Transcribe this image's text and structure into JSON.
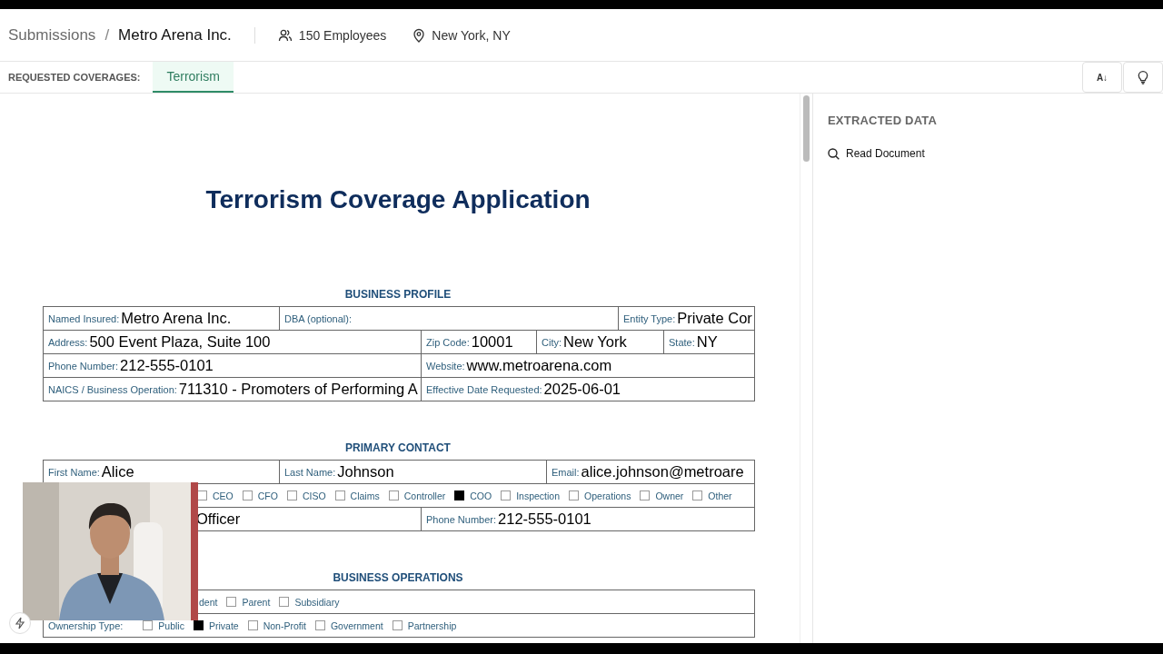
{
  "header": {
    "breadcrumb": [
      {
        "label": "Submissions",
        "selected": false
      },
      {
        "label": "Metro Arena Inc.",
        "selected": true
      }
    ],
    "separator": "/",
    "employees": "150 Employees",
    "location": "New York, NY"
  },
  "coverages": {
    "label": "REQUESTED COVERAGES:",
    "tabs": [
      {
        "label": "Terrorism",
        "selected": true
      }
    ]
  },
  "toolbar": {
    "sort_button": "A↓"
  },
  "document": {
    "title": "Terrorism Coverage Application",
    "sections": [
      {
        "heading": "BUSINESS PROFILE",
        "lines": [
          {
            "fields": [
              {
                "kind": "field",
                "label": "Named Insured:",
                "value": "Metro Arena Inc."
              },
              {
                "kind": "field",
                "label": "DBA (optional):"
              },
              {
                "kind": "field",
                "label": "Entity Type:",
                "value": "Private Cor"
              }
            ]
          },
          {
            "fields": [
              {
                "kind": "field",
                "label": "Address:",
                "value": "500 Event Plaza, Suite 100"
              },
              {
                "kind": "field",
                "label": "Zip Code:",
                "value": "10001"
              },
              {
                "kind": "field",
                "label": "City:",
                "value": "New York"
              },
              {
                "kind": "field",
                "label": "State:",
                "value": "NY"
              }
            ]
          },
          {
            "fields": [
              {
                "kind": "field",
                "label": "Phone Number:",
                "value": "212-555-0101"
              },
              {
                "kind": "field",
                "label": "Website:",
                "value": "www.metroarena.com"
              }
            ]
          },
          {
            "fields": [
              {
                "kind": "field",
                "label": "NAICS / Business Operation:",
                "value": "711310 - Promoters of Performing A"
              },
              {
                "kind": "field",
                "label": "Effective Date Requested:",
                "value": "2025-06-01"
              }
            ]
          }
        ]
      },
      {
        "heading": "PRIMARY CONTACT",
        "lines": [
          {
            "fields": [
              {
                "kind": "field",
                "label": "First Name:",
                "value": "Alice"
              },
              {
                "kind": "field",
                "label": "Last Name:",
                "value": "Johnson"
              },
              {
                "kind": "field",
                "label": "Email:",
                "value": "alice.johnson@metroare"
              }
            ]
          },
          {
            "fields": [
              {
                "kind": "options",
                "items": [
                  {
                    "kind": "checkbox",
                    "label": "CEO",
                    "checked": false
                  },
                  {
                    "kind": "checkbox",
                    "label": "CFO",
                    "checked": false
                  },
                  {
                    "kind": "checkbox",
                    "label": "CISO",
                    "checked": false
                  },
                  {
                    "kind": "checkbox",
                    "label": "Claims",
                    "checked": false
                  },
                  {
                    "kind": "checkbox",
                    "label": "Controller",
                    "checked": false
                  },
                  {
                    "kind": "checkbox",
                    "label": "COO",
                    "checked": true
                  },
                  {
                    "kind": "checkbox",
                    "label": "Inspection",
                    "checked": false
                  },
                  {
                    "kind": "checkbox",
                    "label": "Operations",
                    "checked": false
                  },
                  {
                    "kind": "checkbox",
                    "label": "Owner",
                    "checked": false
                  },
                  {
                    "kind": "checkbox",
                    "label": "Other",
                    "checked": false
                  }
                ]
              }
            ]
          },
          {
            "fields": [
              {
                "kind": "field",
                "value": "Officer"
              },
              {
                "kind": "field",
                "label": "Phone Number:",
                "value": "212-555-0101"
              }
            ]
          }
        ]
      },
      {
        "heading": "BUSINESS OPERATIONS",
        "lines": [
          {
            "fields": [
              {
                "kind": "options",
                "items": [
                  {
                    "kind": "text",
                    "label": "dent"
                  },
                  {
                    "kind": "checkbox",
                    "label": "Parent",
                    "checked": false
                  },
                  {
                    "kind": "checkbox",
                    "label": "Subsidiary",
                    "checked": false
                  }
                ]
              }
            ]
          },
          {
            "fields": [
              {
                "kind": "options",
                "items": [
                  {
                    "kind": "label",
                    "label": "Ownership Type:"
                  },
                  {
                    "kind": "checkbox",
                    "label": "Public",
                    "checked": false
                  },
                  {
                    "kind": "checkbox",
                    "label": "Private",
                    "checked": true
                  },
                  {
                    "kind": "checkbox",
                    "label": "Non-Profit",
                    "checked": false
                  },
                  {
                    "kind": "checkbox",
                    "label": "Government",
                    "checked": false
                  },
                  {
                    "kind": "checkbox",
                    "label": "Partnership",
                    "checked": false
                  }
                ]
              }
            ]
          }
        ]
      }
    ]
  },
  "extracted": {
    "title": "EXTRACTED DATA",
    "items": [
      {
        "label": "Read Document"
      }
    ]
  }
}
